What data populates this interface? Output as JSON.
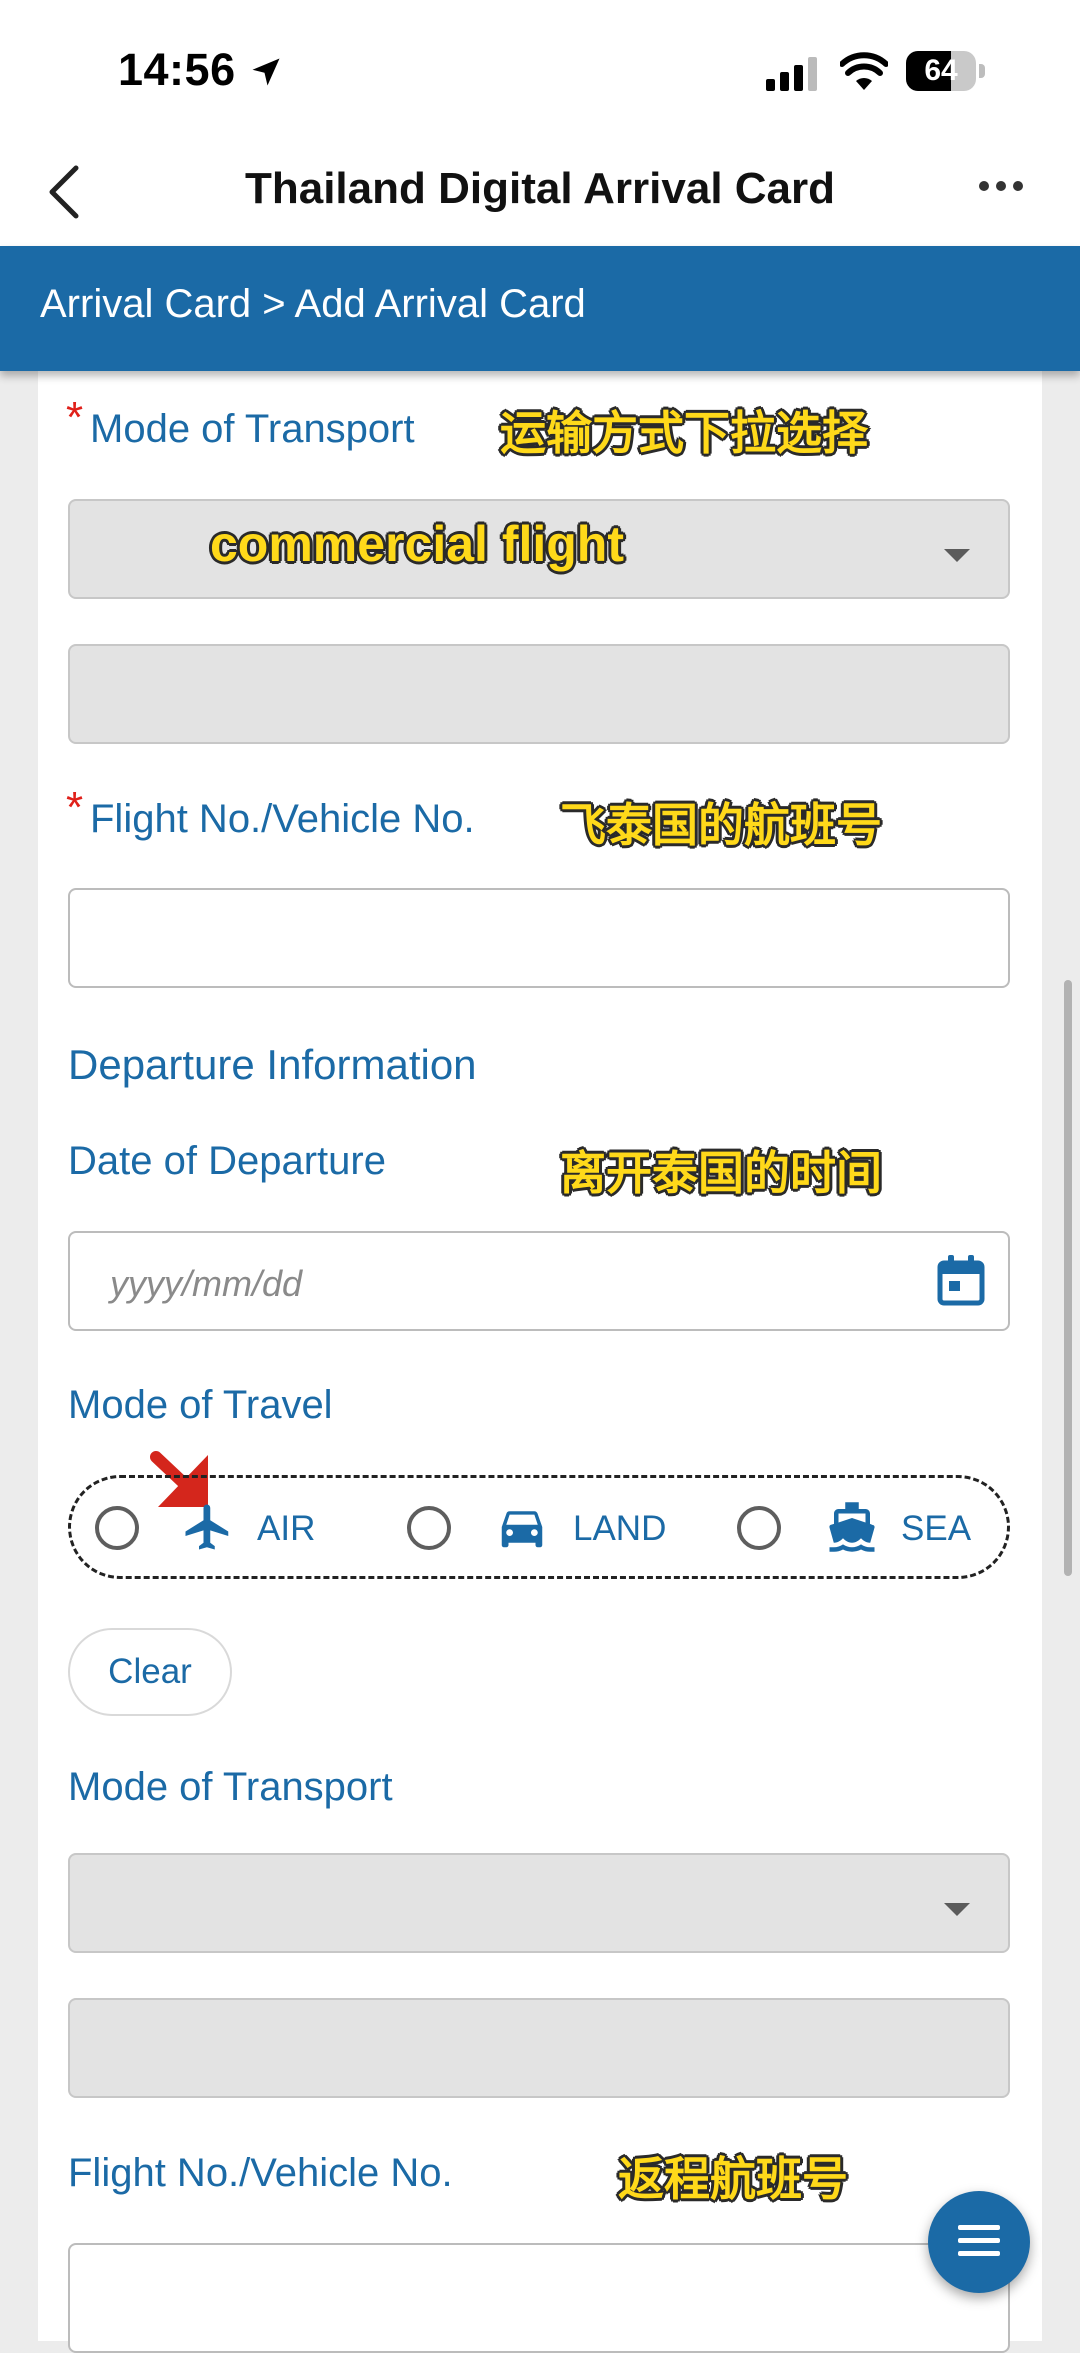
{
  "status_bar": {
    "time": "14:56",
    "battery": "64",
    "battery_level": 0.64
  },
  "nav": {
    "title": "Thailand Digital Arrival Card"
  },
  "breadcrumb": "Arrival Card > Add Arrival Card",
  "arrival": {
    "required_mark": "*",
    "mode_of_transport_label": "Mode of Transport",
    "mode_of_transport_value": "commercial flight",
    "flight_no_label": "Flight No./Vehicle No."
  },
  "departure": {
    "section_title": "Departure Information",
    "date_label": "Date of Departure",
    "date_placeholder": "yyyy/mm/dd",
    "mode_of_travel_label": "Mode of Travel",
    "travel_options": [
      {
        "label": "AIR",
        "icon": "airplane-icon"
      },
      {
        "label": "LAND",
        "icon": "car-icon"
      },
      {
        "label": "SEA",
        "icon": "ship-icon"
      }
    ],
    "clear_label": "Clear",
    "mode_of_transport_label": "Mode of Transport",
    "flight_no_label": "Flight No./Vehicle No."
  },
  "annotations": {
    "transport": "运输方式下拉选择",
    "flight": "飞泰国的航班号",
    "departure_date": "离开泰国的时间",
    "return_flight": "返程航班号"
  },
  "colors": {
    "brand_blue": "#1b6aa6",
    "required_red": "#e0201a",
    "annotation_yellow": "#ffd91a"
  }
}
